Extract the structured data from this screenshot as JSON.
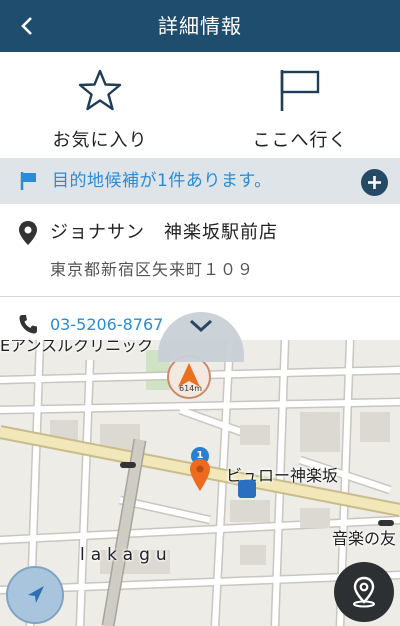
{
  "header": {
    "title": "詳細情報",
    "back_icon": "chevron-left-icon",
    "background": "#1f4d6e"
  },
  "actions": {
    "favorite_label": "お気に入り",
    "favorite_icon": "star-outline-icon",
    "go_here_label": "ここへ行く",
    "go_here_icon": "flag-outline-icon"
  },
  "candidates": {
    "text": "目的地候補が1件あります。",
    "flag_icon": "flag-icon",
    "add_icon": "plus-circle-icon",
    "accent": "#2a8bd6"
  },
  "place": {
    "name": "ジョナサン　神楽坂駅前店",
    "address": "東京都新宿区矢来町１０９",
    "pin_icon": "location-pin-icon"
  },
  "phone": {
    "number": "03-5206-8767",
    "icon": "phone-icon"
  },
  "map": {
    "label_clinic": "Eアンスルクリニック",
    "label_station": "ビュロー神楽坂",
    "label_music": "音楽の友",
    "label_lakagu": "lakagu",
    "nav_distance": "614m",
    "badge_count": "1",
    "collapse_icon": "chevron-down-icon",
    "locate_icon": "navigation-arrow-icon",
    "route_icon": "route-pin-icon"
  }
}
